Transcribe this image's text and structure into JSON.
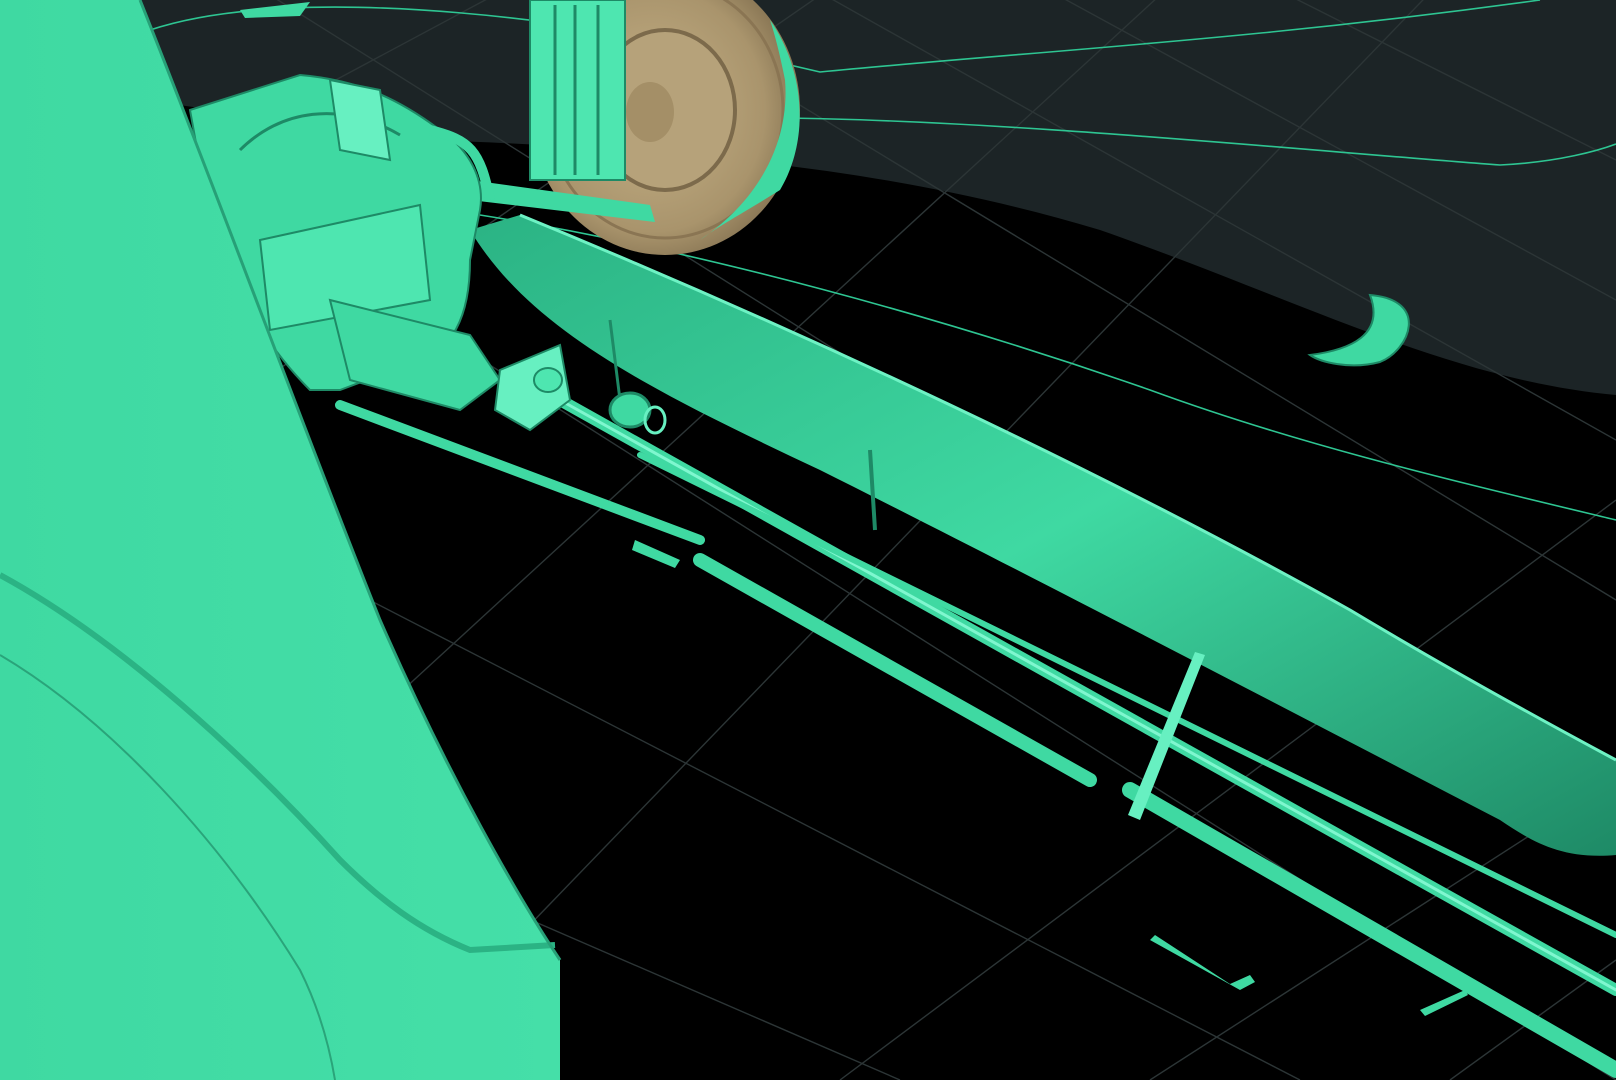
{
  "viewport": {
    "kind": "3d-viewport",
    "colors": {
      "background_dark": "#1c2426",
      "background_black": "#000000",
      "grid_line": "#2c3536",
      "model_fill": "#3fd9a2",
      "model_highlight": "#67f0c1",
      "model_shadow": "#1e8a66",
      "wire_line": "#2ec592",
      "tire_fill": "#b6a27a",
      "tire_dark": "#8a7553"
    }
  },
  "scene": {
    "objects": [
      "body-panel",
      "engine-assembly",
      "wheel",
      "chassis-beam",
      "frame-rail",
      "fuel-line",
      "brake-line",
      "crossmember-bracket",
      "exhaust-hanger"
    ]
  }
}
